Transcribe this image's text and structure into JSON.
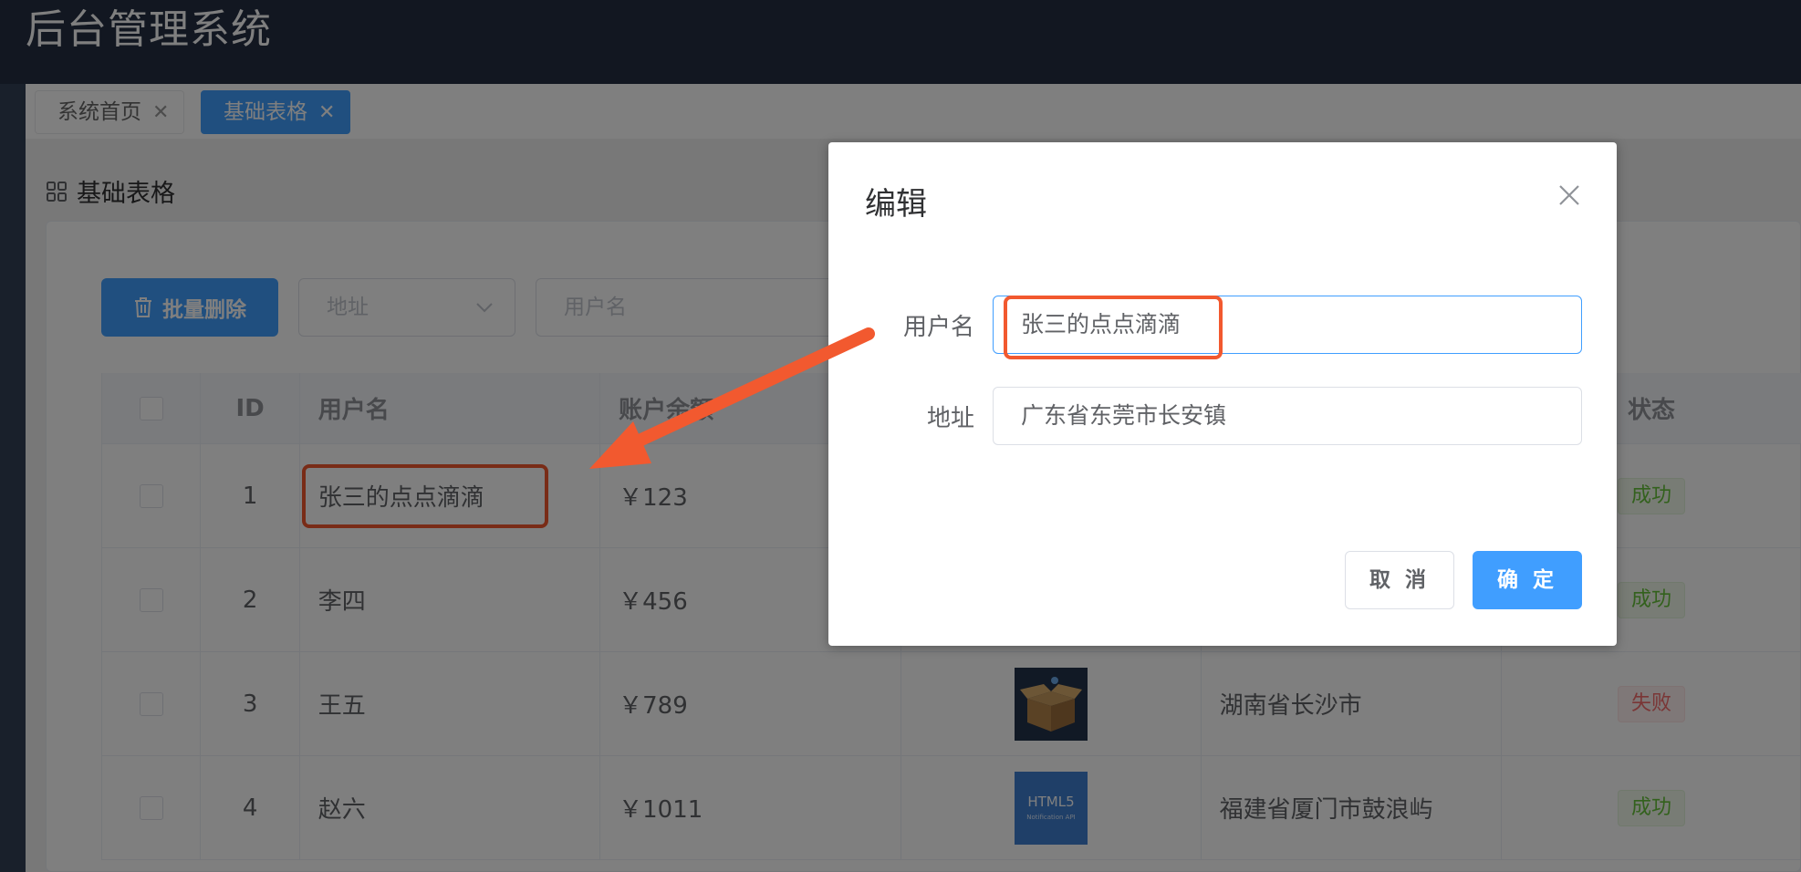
{
  "app": {
    "title": "后台管理系统"
  },
  "tags": [
    {
      "label": "系统首页",
      "active": false
    },
    {
      "label": "基础表格",
      "active": true
    }
  ],
  "page": {
    "breadcrumb": "基础表格"
  },
  "toolbar": {
    "batch_delete_label": "批量删除",
    "address_select_placeholder": "地址",
    "username_placeholder": "用户名"
  },
  "table": {
    "headers": {
      "id": "ID",
      "name": "用户名",
      "balance": "账户余额",
      "status": "状态"
    },
    "rows": [
      {
        "id": "1",
        "name": "张三的点点滴滴",
        "balance": "￥123",
        "address": "",
        "status": "成功",
        "status_type": "success"
      },
      {
        "id": "2",
        "name": "李四",
        "balance": "￥456",
        "address": "",
        "status": "成功",
        "status_type": "success"
      },
      {
        "id": "3",
        "name": "王五",
        "balance": "￥789",
        "address": "湖南省长沙市",
        "status": "失败",
        "status_type": "fail"
      },
      {
        "id": "4",
        "name": "赵六",
        "balance": "￥1011",
        "address": "福建省厦门市鼓浪屿",
        "status": "成功",
        "status_type": "success"
      }
    ],
    "row4_thumb_text": "HTML5",
    "row4_thumb_subtext": "Notification API"
  },
  "dialog": {
    "title": "编辑",
    "username_label": "用户名",
    "username_value": "张三的点点滴滴",
    "address_label": "地址",
    "address_value": "广东省东莞市长安镇",
    "cancel_label": "取 消",
    "confirm_label": "确 定"
  },
  "colors": {
    "header_bg": "#242f42",
    "primary": "#409eff",
    "annotation": "#f2592f",
    "success": "#67c23a",
    "danger": "#f56c6c"
  }
}
